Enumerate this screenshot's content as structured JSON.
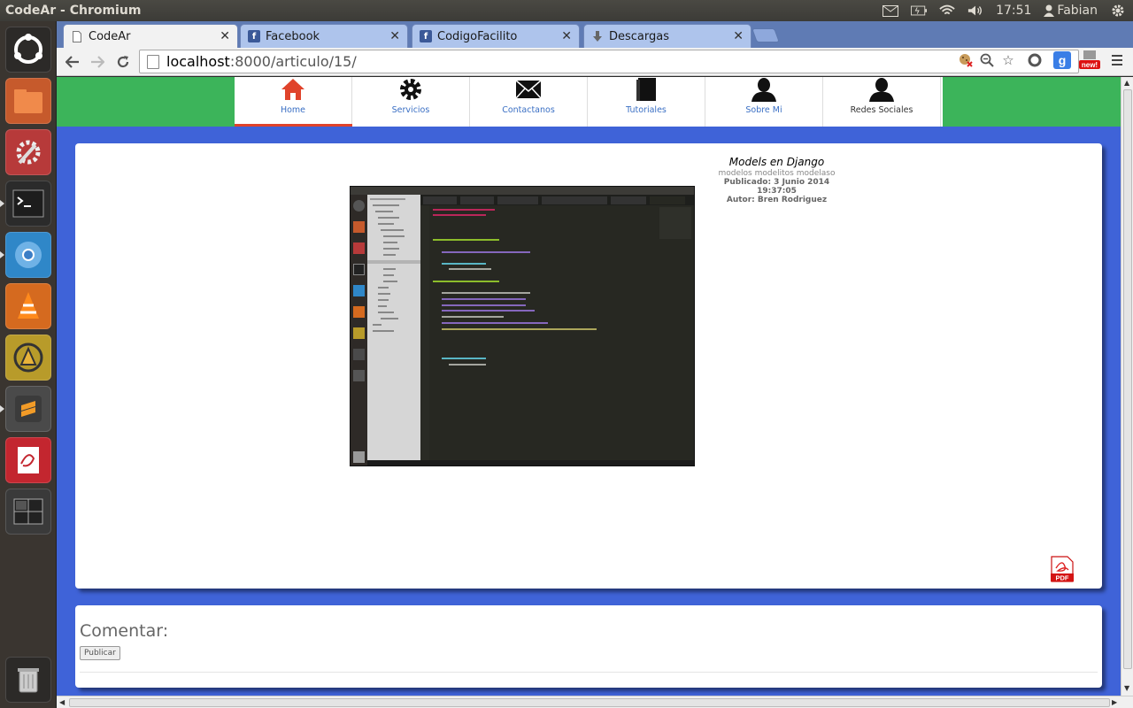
{
  "window": {
    "title": "CodeAr - Chromium"
  },
  "panel": {
    "clock": "17:51",
    "user": "Fabian"
  },
  "tabs": [
    {
      "label": "CodeAr",
      "active": true
    },
    {
      "label": "Facebook",
      "active": false
    },
    {
      "label": "CodigoFacilito",
      "active": false
    },
    {
      "label": "Descargas",
      "active": false
    }
  ],
  "address": {
    "host": "localhost",
    "rest": ":8000/articulo/15/"
  },
  "nav": {
    "items": [
      {
        "label": "Home",
        "icon": "home-icon"
      },
      {
        "label": "Servicios",
        "icon": "gear-icon"
      },
      {
        "label": "Contactanos",
        "icon": "envelope-icon"
      },
      {
        "label": "Tutoriales",
        "icon": "book-icon"
      },
      {
        "label": "Sobre Mi",
        "icon": "user-icon"
      },
      {
        "label": "Redes Sociales",
        "icon": "user-icon"
      }
    ]
  },
  "article": {
    "title": "Models en Django",
    "tags": "modelos modelitos modelaso",
    "published": "Publicado: 3 Junio 2014 19:37:05",
    "author": "Autor: Bren Rodriguez",
    "pdf_label": "PDF"
  },
  "comments": {
    "title": "Comentar:",
    "button": "Publicar"
  },
  "colors": {
    "navbar": "#3cb45a",
    "background": "#3f63d8",
    "accent": "#e0432b",
    "link": "#3a6fc4"
  }
}
